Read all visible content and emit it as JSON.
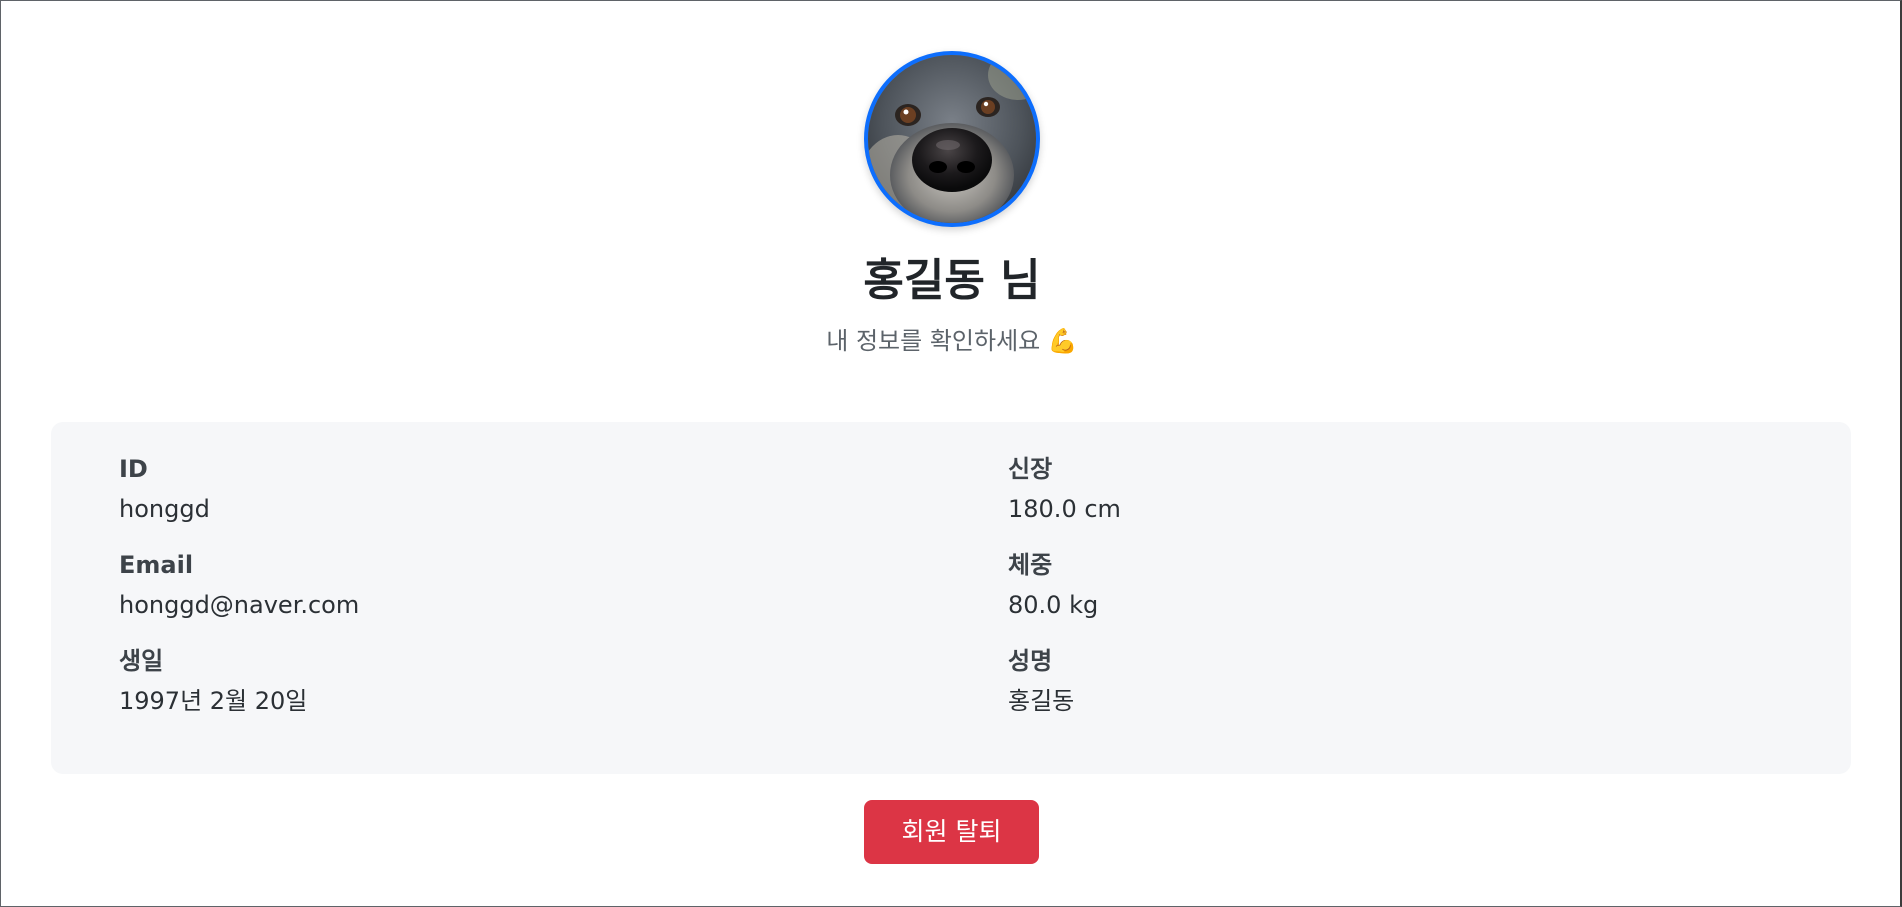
{
  "profile": {
    "avatar_alt": "dog profile photo",
    "display_name": "홍길동 님",
    "subtitle": "내 정보를 확인하세요 💪"
  },
  "fields": {
    "id": {
      "label": "ID",
      "value": "honggd"
    },
    "email": {
      "label": "Email",
      "value": "honggd@naver.com"
    },
    "birthday": {
      "label": "생일",
      "value": "1997년 2월 20일"
    },
    "height": {
      "label": "신장",
      "value": "180.0 cm"
    },
    "weight": {
      "label": "체중",
      "value": "80.0 kg"
    },
    "fullname": {
      "label": "성명",
      "value": "홍길동"
    }
  },
  "actions": {
    "withdraw_label": "회원 탈퇴"
  },
  "colors": {
    "accent": "#0d6efd",
    "danger": "#dc3545",
    "card_bg": "#f6f7f9"
  }
}
